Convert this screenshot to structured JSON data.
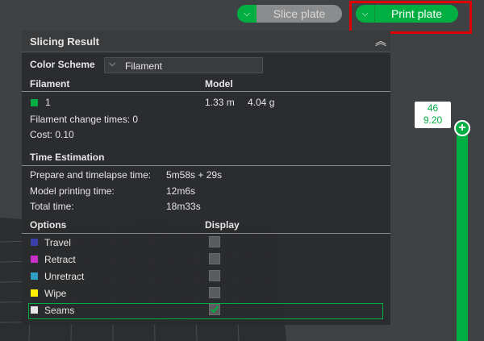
{
  "toolbar": {
    "slice_label": "Slice plate",
    "print_label": "Print plate",
    "caret": "⌵"
  },
  "panel": {
    "title": "Slicing Result",
    "collapse_icon": "︽",
    "color_scheme_label": "Color Scheme",
    "color_scheme_value": "Filament",
    "filament_header": "Filament",
    "model_header": "Model",
    "filament_row": {
      "index": "1",
      "length": "1.33 m",
      "weight": "4.04 g",
      "color": "#00ae42"
    },
    "change_times": "Filament change times:  0",
    "cost": "Cost:  0.10",
    "time_title": "Time Estimation",
    "prepare_label": "Prepare and timelapse time:",
    "prepare_value": "5m58s + 29s",
    "model_time_label": "Model printing time:",
    "model_time_value": "12m6s",
    "total_label": "Total time:",
    "total_value": "18m33s",
    "options_header": "Options",
    "display_header": "Display",
    "options": [
      {
        "label": "Travel",
        "color": "#3b3fa8",
        "checked": false
      },
      {
        "label": "Retract",
        "color": "#c82ec8",
        "checked": false
      },
      {
        "label": "Unretract",
        "color": "#2f9fc6",
        "checked": false
      },
      {
        "label": "Wipe",
        "color": "#ffee00",
        "checked": false
      },
      {
        "label": "Seams",
        "color": "#e6e6e6",
        "checked": true
      }
    ]
  },
  "slider": {
    "layer": "46",
    "height": "9.20"
  },
  "colors": {
    "accent": "#00ae42",
    "highlight": "#e00000"
  }
}
